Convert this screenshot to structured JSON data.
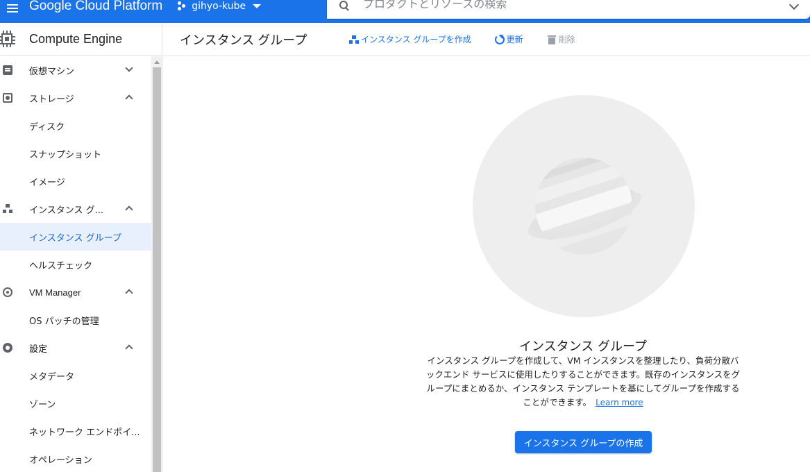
{
  "topbar": {
    "brand": "Google Cloud Platform",
    "project": "gihyo-kube",
    "search_placeholder": "プロダクトとリソースの検索"
  },
  "sidebar": {
    "title": "Compute Engine",
    "items": [
      {
        "label": "仮想マシン",
        "type": "parent",
        "icon": "vm-icon",
        "expanded": false
      },
      {
        "label": "ストレージ",
        "type": "parent",
        "icon": "storage-icon",
        "expanded": true
      },
      {
        "label": "ディスク",
        "type": "child"
      },
      {
        "label": "スナップショット",
        "type": "child"
      },
      {
        "label": "イメージ",
        "type": "child"
      },
      {
        "label": "インスタンス グ...",
        "type": "parent",
        "icon": "instance-group-icon",
        "expanded": true
      },
      {
        "label": "インスタンス グループ",
        "type": "child",
        "active": true
      },
      {
        "label": "ヘルスチェック",
        "type": "child"
      },
      {
        "label": "VM Manager",
        "type": "parent",
        "icon": "vm-manager-icon",
        "expanded": true
      },
      {
        "label": "OS パッチの管理",
        "type": "child"
      },
      {
        "label": "設定",
        "type": "parent",
        "icon": "settings-icon",
        "expanded": true
      },
      {
        "label": "メタデータ",
        "type": "child"
      },
      {
        "label": "ゾーン",
        "type": "child"
      },
      {
        "label": "ネットワーク エンドポイ...",
        "type": "child"
      },
      {
        "label": "オペレーション",
        "type": "child"
      }
    ]
  },
  "actionbar": {
    "title": "インスタンス グループ",
    "create_label": "インスタンス グループを作成",
    "refresh_label": "更新",
    "delete_label": "削除"
  },
  "empty_state": {
    "title": "インスタンス グループ",
    "description": "インスタンス グループを作成して、VM インスタンスを整理したり、負荷分散バックエンド サービスに使用したりすることができます。既存のインスタンスをグループにまとめるか、インスタンス テンプレートを基にしてグループを作成することができます。",
    "learn_more": "Learn more",
    "button_label": "インスタンス グループの作成"
  },
  "colors": {
    "accent": "#1a73e8",
    "active_bg": "#e8f0fe",
    "illustration_circle": "#eeeeee"
  }
}
